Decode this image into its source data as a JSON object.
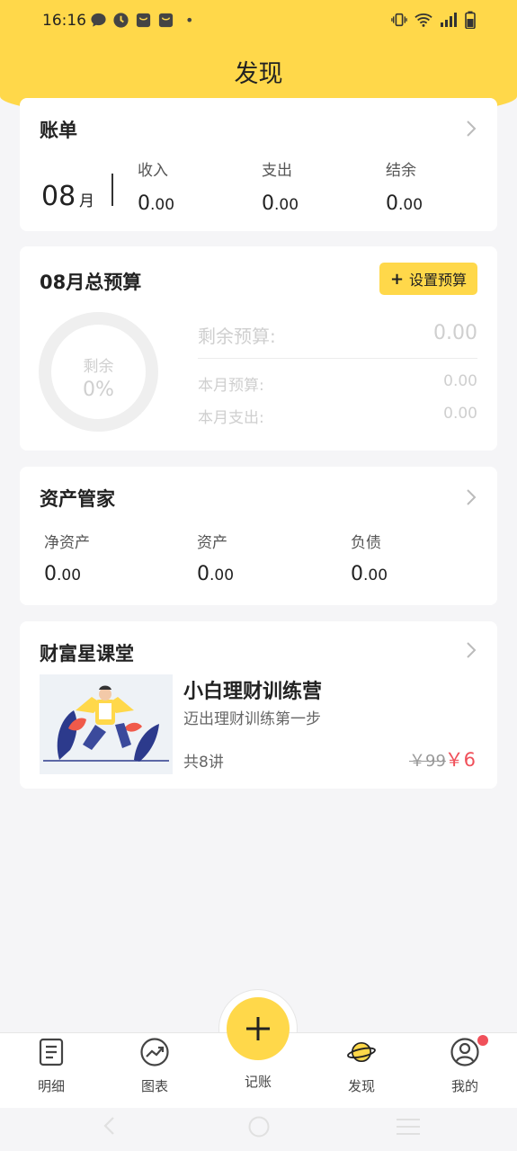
{
  "status_bar": {
    "time": "16:16",
    "notification_icons": [
      "message-icon",
      "clock-app-icon",
      "shopping-bag-icon",
      "shopping-bag-icon"
    ],
    "more_dot": "•",
    "right_icons": [
      "vibrate-icon",
      "wifi-icon",
      "signal-icon",
      "battery-icon"
    ]
  },
  "page_title": "发现",
  "bill": {
    "title": "账单",
    "month": "08",
    "month_unit": "月",
    "income_label": "收入",
    "income_int": "0",
    "income_dec": ".00",
    "expense_label": "支出",
    "expense_int": "0",
    "expense_dec": ".00",
    "balance_label": "结余",
    "balance_int": "0",
    "balance_dec": ".00"
  },
  "budget": {
    "title": "08月总预算",
    "set_button": "设置预算",
    "ring_label": "剩余",
    "ring_percent": "0%",
    "remaining_label": "剩余预算:",
    "remaining_value": "0.00",
    "month_budget_label": "本月预算:",
    "month_budget_value": "0.00",
    "month_expense_label": "本月支出:",
    "month_expense_value": "0.00"
  },
  "assets": {
    "title": "资产管家",
    "net_label": "净资产",
    "net_int": "0",
    "net_dec": ".00",
    "asset_label": "资产",
    "asset_int": "0",
    "asset_dec": ".00",
    "debt_label": "负债",
    "debt_int": "0",
    "debt_dec": ".00"
  },
  "course": {
    "section_title": "财富星课堂",
    "name": "小白理财训练营",
    "subtitle": "迈出理财训练第一步",
    "count": "共8讲",
    "old_price": "￥99",
    "new_price": "￥6"
  },
  "tabs": [
    {
      "label": "明细",
      "icon": "list-detail-icon"
    },
    {
      "label": "图表",
      "icon": "chart-trend-icon"
    },
    {
      "label": "记账",
      "icon": "plus-icon"
    },
    {
      "label": "发现",
      "icon": "planet-icon"
    },
    {
      "label": "我的",
      "icon": "user-icon"
    }
  ],
  "colors": {
    "accent": "#ffd84a",
    "price_red": "#f0505a",
    "background": "#f5f5f7"
  }
}
